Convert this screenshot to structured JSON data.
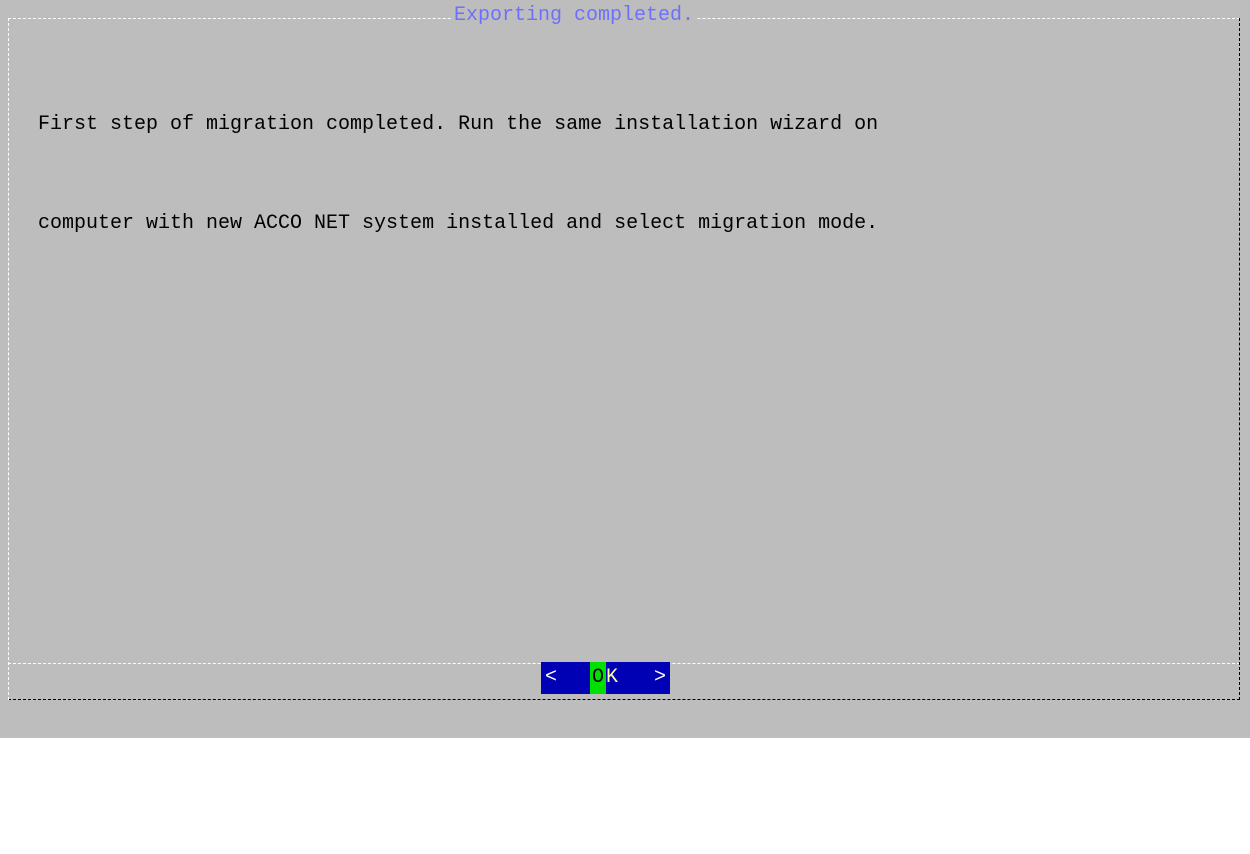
{
  "dialog": {
    "title": "Exporting completed.",
    "message_lines": [
      "First step of migration completed. Run the same installation wizard on",
      "computer with new ACCO NET system installed and select migration mode."
    ]
  },
  "button": {
    "left_bracket": "<",
    "hotkey": "O",
    "label_rest": "K",
    "right_bracket": ">"
  },
  "colors": {
    "background": "#bdbdbd",
    "title": "#6f6fff",
    "button_bg": "#0000b4",
    "hotkey_bg": "#00e000"
  }
}
